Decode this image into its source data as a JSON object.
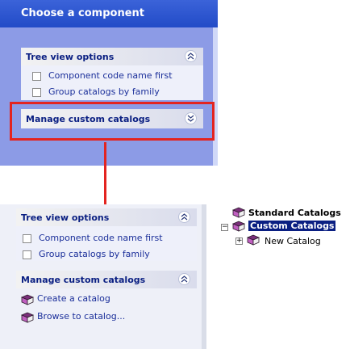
{
  "top": {
    "title": "Choose a component",
    "tree_view": {
      "header": "Tree view options",
      "options": [
        {
          "label": "Component code name first"
        },
        {
          "label": "Group catalogs by family"
        }
      ]
    },
    "manage": {
      "header": "Manage custom catalogs"
    }
  },
  "bottom": {
    "tree_view": {
      "header": "Tree view options",
      "options": [
        {
          "label": "Component code name first"
        },
        {
          "label": "Group catalogs by family"
        }
      ]
    },
    "manage": {
      "header": "Manage custom catalogs",
      "actions": [
        {
          "label": "Create a catalog"
        },
        {
          "label": "Browse to catalog..."
        }
      ]
    }
  },
  "tree": {
    "standard": "Standard Catalogs",
    "custom": "Custom Catalogs",
    "new_catalog": "New Catalog",
    "expander_plus": "+",
    "expander_minus": "−"
  },
  "colors": {
    "annotation": "#e32420",
    "link": "#1b2f9a",
    "title_bar": "#224bc7"
  }
}
